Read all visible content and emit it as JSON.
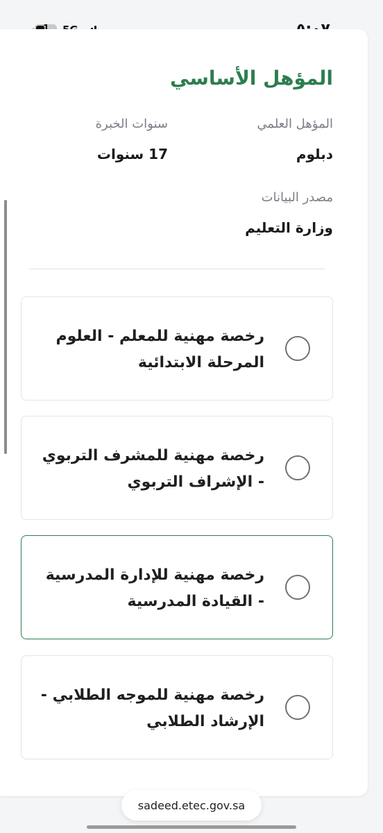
{
  "status_bar": {
    "time": "٥:٠٧",
    "network": "5G",
    "battery_level": "1"
  },
  "qualification": {
    "title": "المؤهل الأساسي",
    "degree_label": "المؤهل العلمي",
    "degree_value": "دبلوم",
    "experience_label": "سنوات الخبرة",
    "experience_value": "17 سنوات",
    "source_label": "مصدر البيانات",
    "source_value": "وزارة التعليم"
  },
  "license_options": [
    {
      "label": "رخصة مهنية للمعلم - العلوم المرحلة الابتدائية",
      "selected": false
    },
    {
      "label": "رخصة مهنية للمشرف التربوي - الإشراف التربوي",
      "selected": false
    },
    {
      "label": "رخصة مهنية للإدارة المدرسية - القيادة المدرسية",
      "selected": false
    },
    {
      "label": "رخصة مهنية للموجه الطلابي - الإرشاد الطلابي",
      "selected": false
    }
  ],
  "browser": {
    "url": "sadeed.etec.gov.sa"
  },
  "colors": {
    "accent": "#2e7d4f",
    "muted_text": "#7a7f85",
    "border": "#e2e5e8"
  }
}
